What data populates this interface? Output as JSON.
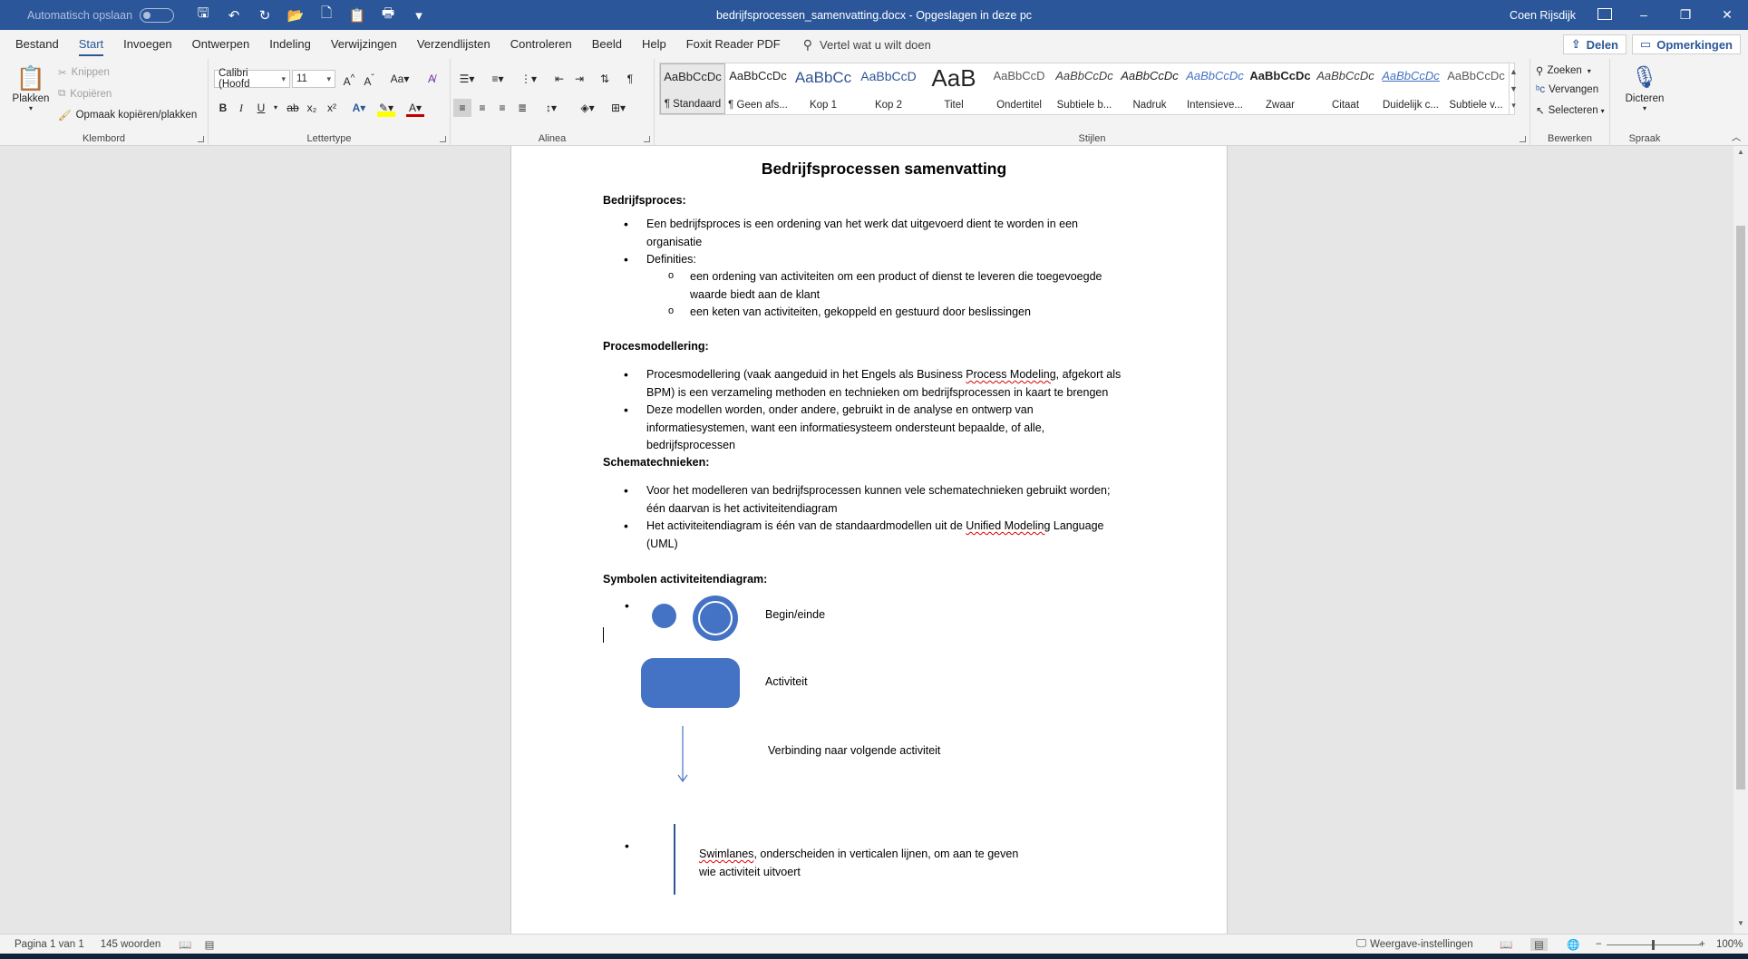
{
  "titlebar": {
    "autosave_label": "Automatisch opslaan",
    "doc_title": "bedrijfsprocessen_samenvatting.docx  -  Opgeslagen in deze pc",
    "user": "Coen Rijsdijk"
  },
  "menu": {
    "tabs": [
      "Bestand",
      "Start",
      "Invoegen",
      "Ontwerpen",
      "Indeling",
      "Verwijzingen",
      "Verzendlijsten",
      "Controleren",
      "Beeld",
      "Help",
      "Foxit Reader PDF"
    ],
    "active_tab": "Start",
    "tell_me": "Vertel wat u wilt doen",
    "share": "Delen",
    "comments": "Opmerkingen"
  },
  "ribbon": {
    "clipboard": {
      "paste": "Plakken",
      "cut": "Knippen",
      "copy": "Kopiëren",
      "format_painter": "Opmaak kopiëren/plakken",
      "label": "Klembord"
    },
    "font": {
      "name": "Calibri (Hoofd",
      "size": "11",
      "label": "Lettertype"
    },
    "paragraph": {
      "label": "Alinea"
    },
    "styles": {
      "label": "Stijlen",
      "items": [
        {
          "preview": "AaBbCcDc",
          "name": "¶ Standaard"
        },
        {
          "preview": "AaBbCcDc",
          "name": "¶ Geen afs..."
        },
        {
          "preview": "AaBbCc",
          "name": "Kop 1"
        },
        {
          "preview": "AaBbCcD",
          "name": "Kop 2"
        },
        {
          "preview": "AaB",
          "name": "Titel"
        },
        {
          "preview": "AaBbCcD",
          "name": "Ondertitel"
        },
        {
          "preview": "AaBbCcDc",
          "name": "Subtiele b..."
        },
        {
          "preview": "AaBbCcDc",
          "name": "Nadruk"
        },
        {
          "preview": "AaBbCcDc",
          "name": "Intensieve..."
        },
        {
          "preview": "AaBbCcDc",
          "name": "Zwaar"
        },
        {
          "preview": "AaBbCcDc",
          "name": "Citaat"
        },
        {
          "preview": "AaBbCcDc",
          "name": "Duidelijk c..."
        },
        {
          "preview": "AaBbCcDc",
          "name": "Subtiele v..."
        }
      ]
    },
    "editing": {
      "find": "Zoeken",
      "replace": "Vervangen",
      "select": "Selecteren",
      "label": "Bewerken"
    },
    "voice": {
      "dictate": "Dicteren",
      "label": "Spraak"
    }
  },
  "document": {
    "title": "Bedrijfsprocessen samenvatting",
    "h1": "Bedrijfsproces:",
    "b1_1": "Een bedrijfsproces is een ordening van het werk dat uitgevoerd dient te worden in een",
    "b1_1b": "organisatie",
    "b1_2": "Definities:",
    "s1_1": "een ordening van activiteiten om een product of dienst te leveren die toegevoegde",
    "s1_1b": "waarde biedt aan de klant",
    "s1_2": "een keten van activiteiten, gekoppeld en gestuurd door beslissingen",
    "h2": "Procesmodellering:",
    "b2_1a": "Procesmodellering (vaak aangeduid in het Engels als Business ",
    "b2_1w": "Process Modeling",
    "b2_1c": ", afgekort als",
    "b2_1d": "BPM) is een verzameling methoden en technieken om bedrijfsprocessen in kaart te brengen",
    "b2_2a": "Deze modellen worden, onder andere, gebruikt in de analyse en ontwerp van",
    "b2_2b": "informatiesystemen, want een informatiesysteem ondersteunt bepaalde, of alle,",
    "b2_2c": "bedrijfsprocessen",
    "h3": "Schematechnieken:",
    "b3_1a": "Voor het modelleren van bedrijfsprocessen kunnen vele schematechnieken gebruikt worden;",
    "b3_1b": "één daarvan is het activiteitendiagram",
    "b3_2a": "Het activiteitendiagram is één van de standaardmodellen uit de ",
    "b3_2w": "Unified Modeling",
    "b3_2c": " Language",
    "b3_2d": "(UML)",
    "h4": "Symbolen activiteitendiagram:",
    "sym_start": "Begin/einde",
    "sym_activity": "Activiteit",
    "sym_arrow": "Verbinding naar volgende activiteit",
    "sym_swim_w": "Swimlanes",
    "sym_swim_a": ", onderscheiden in verticalen lijnen, om aan te geven",
    "sym_swim_b": "wie activiteit uitvoert",
    "symbol_color": "#4472c4"
  },
  "status": {
    "page": "Pagina 1 van 1",
    "words": "145 woorden",
    "display_settings": "Weergave-instellingen",
    "zoom": "100%"
  }
}
